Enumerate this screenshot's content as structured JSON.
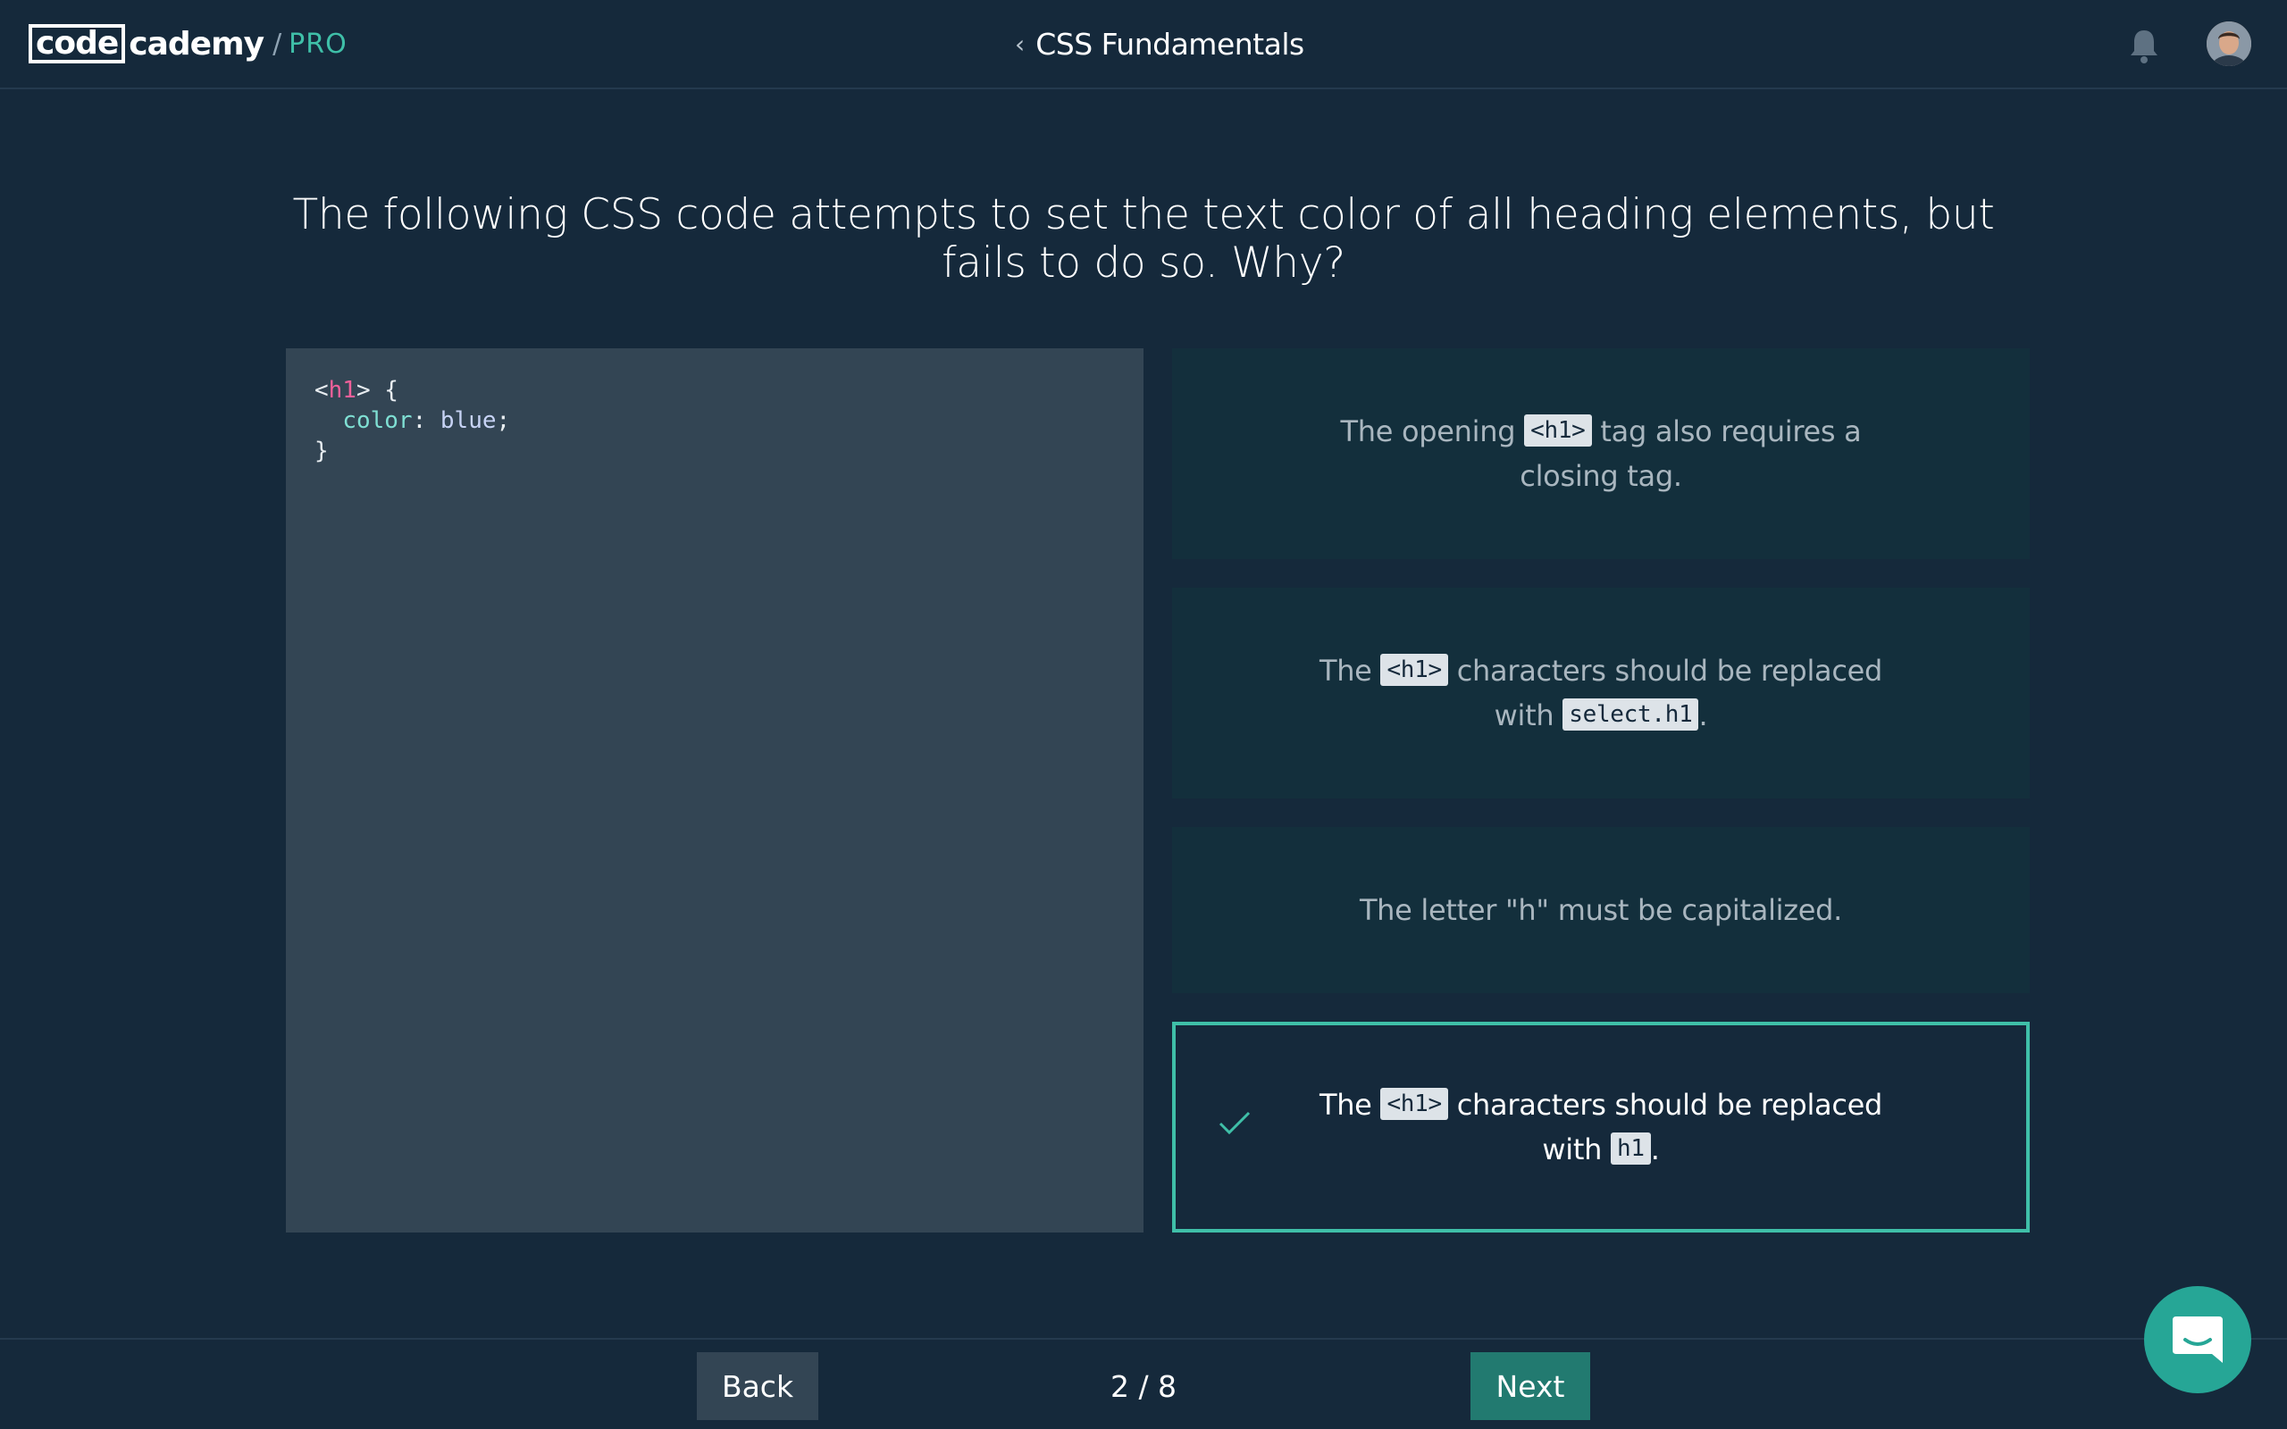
{
  "header": {
    "logo_boxed": "code",
    "logo_rest": "cademy",
    "logo_slash": "/",
    "logo_tier": "PRO",
    "back_chevron": "‹",
    "course_title": "CSS Fundamentals",
    "notification_icon": "bell-icon",
    "avatar_icon": "user-avatar"
  },
  "question": {
    "text": "The following CSS code attempts to set the text color of all heading elements, but fails to do so. Why?"
  },
  "code": {
    "line1": {
      "open": "<",
      "tag": "h1",
      "close": "> {"
    },
    "line2": {
      "indent": "  ",
      "prop": "color",
      "sep": ": ",
      "val": "blue",
      "end": ";"
    },
    "line3": "}"
  },
  "answers": [
    {
      "pre": "The opening ",
      "chip": "<h1>",
      "post": " tag also requires a closing tag.",
      "selected": false
    },
    {
      "pre": "The ",
      "chip": "<h1>",
      "post": " characters should be replaced with ",
      "chip2": "select.h1",
      "post2": ".",
      "selected": false
    },
    {
      "text": "The letter \"h\" must be capitalized.",
      "selected": false
    },
    {
      "pre": "The ",
      "chip": "<h1>",
      "post": " characters should be replaced with ",
      "chip2": "h1",
      "post2": ".",
      "selected": true,
      "mark_icon": "check-icon"
    }
  ],
  "footer": {
    "back_label": "Back",
    "progress": "2 / 8",
    "next_label": "Next",
    "chat_icon": "chat-bubble-icon"
  },
  "colors": {
    "background": "#15293b",
    "accent": "#3fbfa8",
    "code_panel": "#334554",
    "answer_bg": "#132f3c",
    "next_button": "#227a70"
  }
}
